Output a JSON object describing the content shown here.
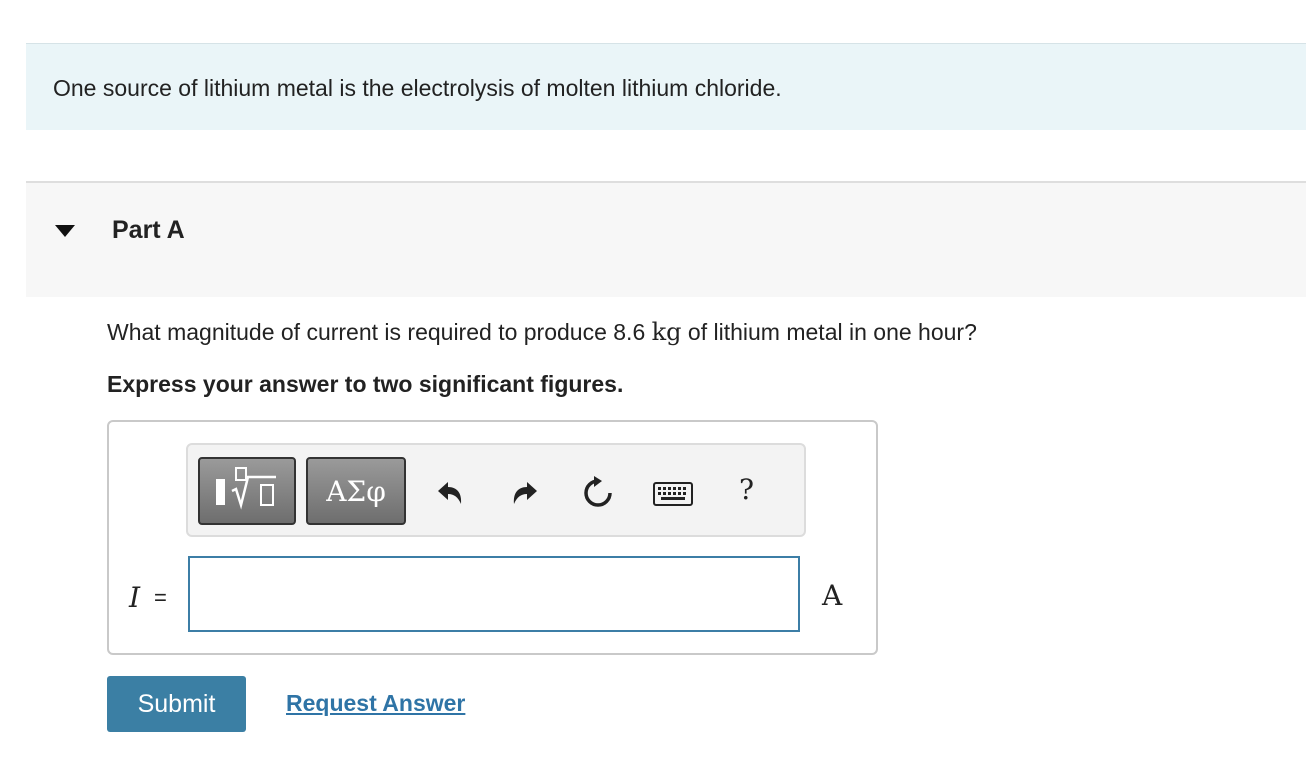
{
  "intro": {
    "text": "One source of lithium metal is the electrolysis of molten lithium chloride."
  },
  "part": {
    "title": "Part A",
    "expanded": true
  },
  "question": {
    "text_before": "What magnitude of current is required to produce 8.6 ",
    "unit": "kg",
    "text_after": " of lithium metal in one hour?",
    "instruction": "Express your answer to two significant figures."
  },
  "toolbar": {
    "symbols_label": "ΑΣφ",
    "help_label": "?",
    "icons": [
      "templates-icon",
      "greek-symbols",
      "undo-icon",
      "redo-icon",
      "reset-icon",
      "keyboard-icon",
      "help-icon"
    ]
  },
  "answer": {
    "variable": "I",
    "equals": "=",
    "value": "",
    "unit": "A"
  },
  "actions": {
    "submit_label": "Submit",
    "request_label": "Request Answer"
  },
  "colors": {
    "intro_bg": "#eaf5f8",
    "accent": "#3b7fa4",
    "link": "#2f74a6"
  }
}
